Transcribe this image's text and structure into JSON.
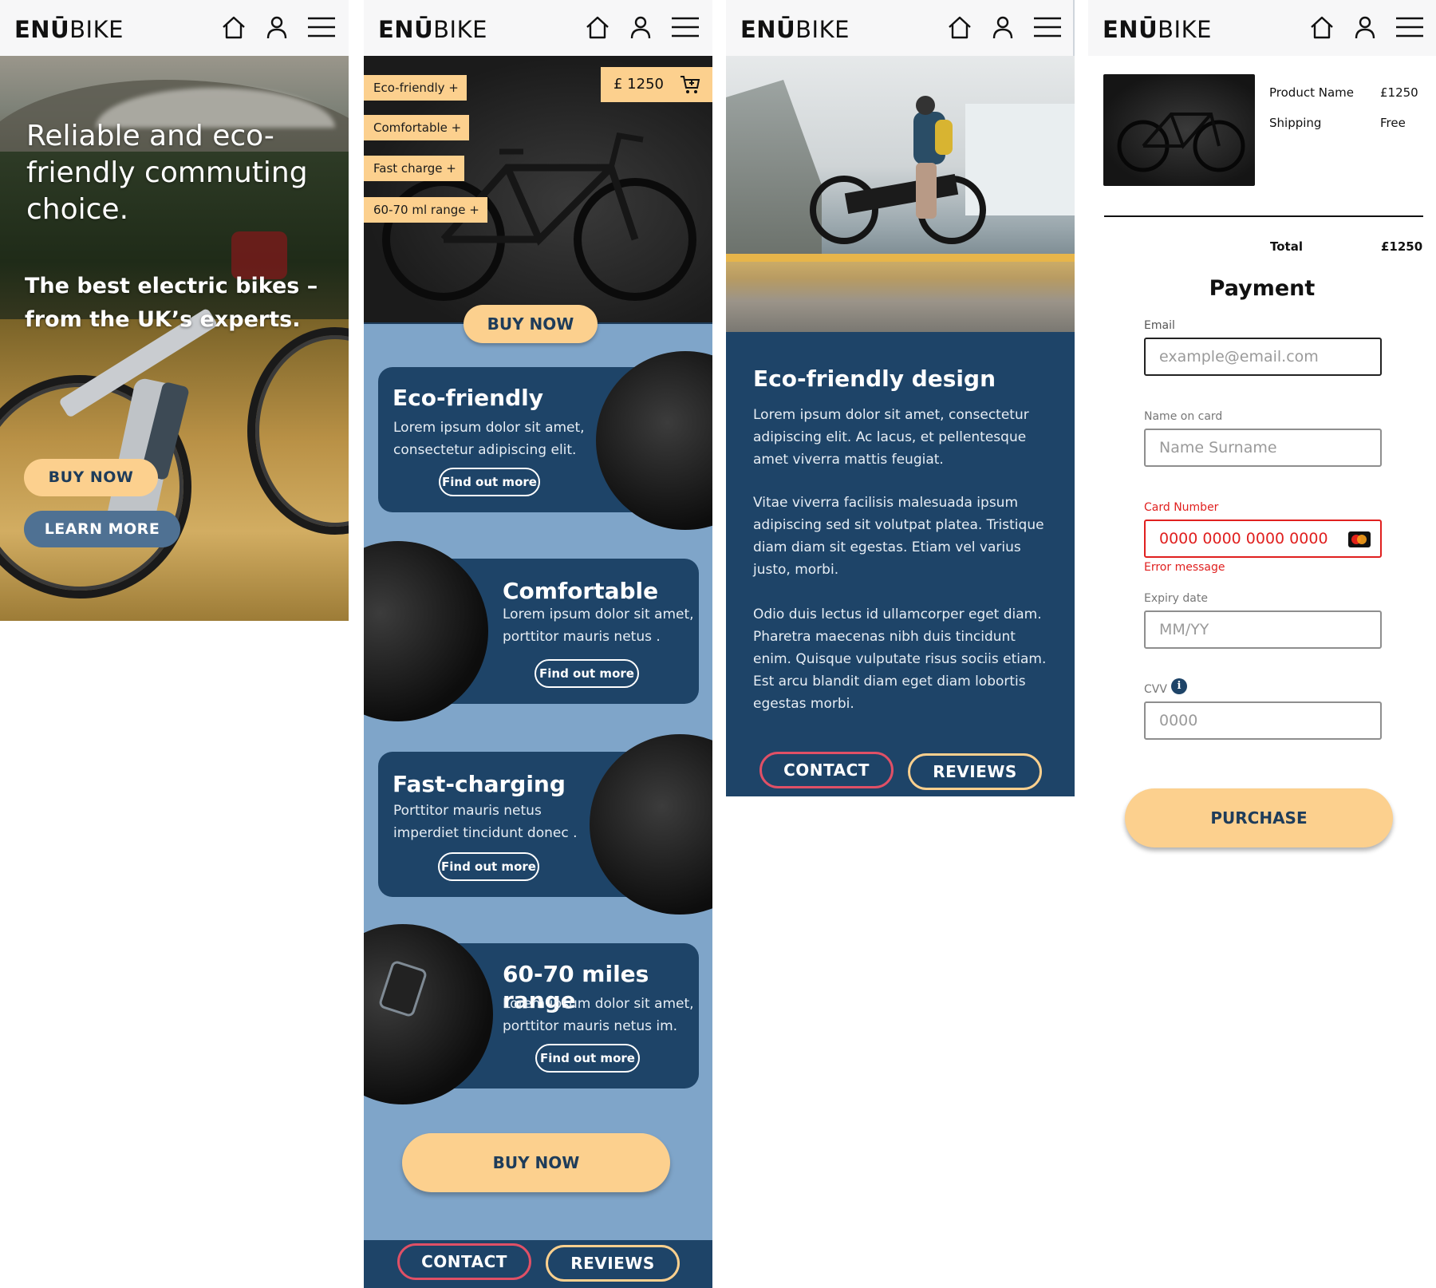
{
  "brand": {
    "logo_bold": "ENŪ",
    "logo_rest": "BIKE"
  },
  "icons": {
    "home": "home-icon",
    "user": "user-icon",
    "menu": "hamburger-menu-icon",
    "cart": "add-to-cart-icon",
    "info": "info-icon",
    "card": "mastercard-icon"
  },
  "colors": {
    "navy": "#1e4468",
    "light_blue": "#7fa5c9",
    "peach": "#fcd08e",
    "red": "#e05066",
    "error": "#e0201f"
  },
  "screen1": {
    "headline": "Reliable and eco-friendly commuting  choice.",
    "subline": "The best electric bikes – from the UK’s experts.",
    "buy_label": "BUY NOW",
    "learn_label": "LEARN MORE"
  },
  "screen2": {
    "tags": [
      "Eco-friendly +",
      "Comfortable +",
      "Fast charge +",
      "60-70 ml range +"
    ],
    "price": "£ 1250",
    "buy_label": "BUY NOW",
    "features": [
      {
        "title": "Eco-friendly",
        "desc": "Lorem ipsum dolor sit amet, consectetur adipiscing elit.",
        "button": "Find out more"
      },
      {
        "title": "Comfortable",
        "desc": "Lorem ipsum dolor sit amet, porttitor mauris netus .",
        "button": "Find out more"
      },
      {
        "title": "Fast-charging",
        "desc": "Porttitor mauris netus imperdiet tincidunt donec .",
        "button": "Find out more"
      },
      {
        "title": "60-70 miles range",
        "desc": "Lorem ipsum dolor sit amet, porttitor mauris netus im.",
        "button": "Find out more"
      }
    ],
    "buy_bottom_label": "BUY NOW",
    "contact_label": "CONTACT",
    "reviews_label": "REVIEWS"
  },
  "screen3": {
    "title": "Eco-friendly design",
    "paragraphs": [
      "Lorem ipsum dolor sit amet, consectetur adipiscing elit. Ac lacus, et pellentesque amet viverra mattis feugiat.",
      "Vitae viverra facilisis malesuada ipsum adipiscing sed sit volutpat platea. Tristique diam diam sit egestas. Etiam vel varius justo, morbi.",
      "Odio duis lectus id ullamcorper eget diam. Pharetra maecenas nibh duis tincidunt enim. Quisque vulputate risus sociis etiam. Est arcu blandit diam eget diam lobortis egestas morbi."
    ],
    "contact_label": "CONTACT",
    "reviews_label": "REVIEWS"
  },
  "screen4": {
    "product_label": "Product Name",
    "product_price": "£1250",
    "shipping_label": "Shipping",
    "shipping_value": "Free",
    "total_label": "Total",
    "total_value": "£1250",
    "payment_title": "Payment",
    "email_label": "Email",
    "email_placeholder": "example@email.com",
    "name_label": "Name on card",
    "name_placeholder": "Name Surname",
    "card_label": "Card Number",
    "card_placeholder": "0000 0000 0000 0000",
    "error_message": "Error message",
    "expiry_label": "Expiry date",
    "expiry_placeholder": "MM/YY",
    "cvv_label": "CVV",
    "cvv_placeholder": "0000",
    "purchase_label": "PURCHASE"
  }
}
